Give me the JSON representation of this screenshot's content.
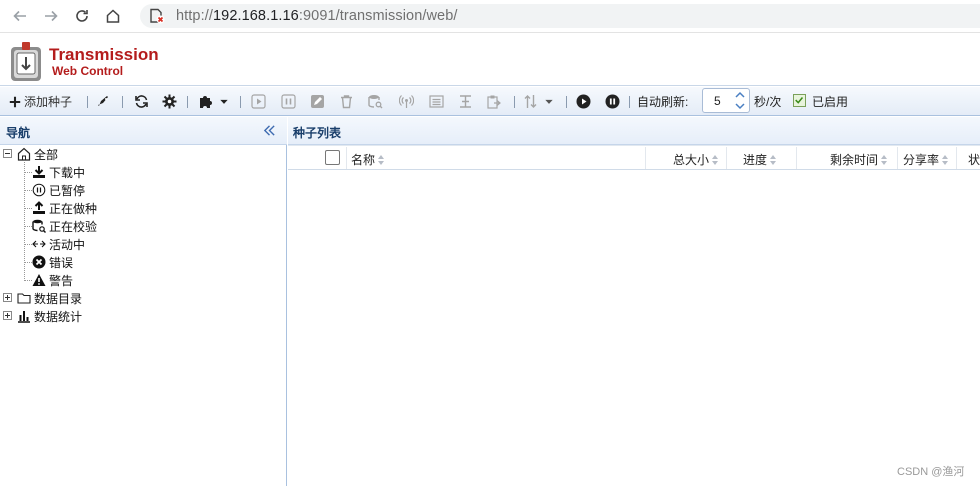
{
  "browser": {
    "url_host": "192.168.1.16",
    "url_port_path": ":9091/transmission/web/",
    "url_scheme": "http://"
  },
  "app": {
    "title": "Transmission",
    "subtitle": "Web Control"
  },
  "toolbar": {
    "add_label": "添加种子",
    "auto_refresh_label": "自动刷新:",
    "refresh_value": "5",
    "unit_label": "秒/次",
    "enabled_label": "已启用"
  },
  "nav": {
    "title": "导航",
    "root_label": "全部",
    "items": [
      {
        "label": "下载中",
        "icon": "download-icon"
      },
      {
        "label": "已暂停",
        "icon": "pause-circle-icon"
      },
      {
        "label": "正在做种",
        "icon": "upload-icon"
      },
      {
        "label": "正在校验",
        "icon": "verify-icon"
      },
      {
        "label": "活动中",
        "icon": "active-icon"
      },
      {
        "label": "错误",
        "icon": "error-icon"
      },
      {
        "label": "警告",
        "icon": "warning-icon"
      }
    ],
    "groups": [
      {
        "label": "数据目录",
        "icon": "folder-icon"
      },
      {
        "label": "数据统计",
        "icon": "stats-icon"
      }
    ]
  },
  "list": {
    "title": "种子列表",
    "columns": [
      "名称",
      "总大小",
      "进度",
      "剩余时间",
      "分享率",
      "状"
    ]
  },
  "watermark": "CSDN @渔河"
}
